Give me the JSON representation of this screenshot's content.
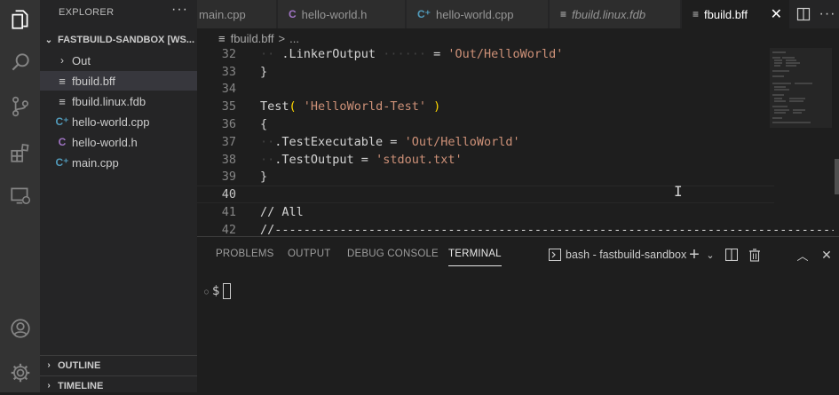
{
  "sidebar": {
    "title": "EXPLORER",
    "more_icon": "ellipsis-icon",
    "workspace": "FASTBUILD-SANDBOX [WS...",
    "files": [
      {
        "label": "Out",
        "kind": "folder"
      },
      {
        "label": "fbuild.bff",
        "kind": "bff",
        "selected": true
      },
      {
        "label": "fbuild.linux.fdb",
        "kind": "fdb"
      },
      {
        "label": "hello-world.cpp",
        "kind": "cpp"
      },
      {
        "label": "hello-world.h",
        "kind": "h"
      },
      {
        "label": "main.cpp",
        "kind": "cpp"
      }
    ],
    "outline": "OUTLINE",
    "timeline": "TIMELINE"
  },
  "tabs": [
    {
      "label": "main.cpp",
      "icon": "cpp-icon",
      "active": false
    },
    {
      "label": "hello-world.h",
      "icon": "c-icon",
      "active": false
    },
    {
      "label": "hello-world.cpp",
      "icon": "cpp-icon",
      "active": false
    },
    {
      "label": "fbuild.linux.fdb",
      "icon": "file-lines-icon",
      "active": false,
      "italic": true
    },
    {
      "label": "fbuild.bff",
      "icon": "file-lines-icon",
      "active": true
    }
  ],
  "breadcrumb": {
    "file": "fbuild.bff",
    "separator": ">",
    "rest": "..."
  },
  "editor": {
    "lines": [
      {
        "n": "32",
        "text": "    .LinkerOutput      = 'Out/HelloWorld'"
      },
      {
        "n": "33",
        "text": "}"
      },
      {
        "n": "34",
        "text": ""
      },
      {
        "n": "35",
        "text": "Test( 'HelloWorld-Test' )"
      },
      {
        "n": "36",
        "text": "{"
      },
      {
        "n": "37",
        "text": "  .TestExecutable = 'Out/HelloWorld'"
      },
      {
        "n": "38",
        "text": "  .TestOutput = 'stdout.txt'"
      },
      {
        "n": "39",
        "text": "}"
      },
      {
        "n": "40",
        "text": ""
      },
      {
        "n": "41",
        "text": "// All"
      },
      {
        "n": "42",
        "text": "//------------------------------------------------------------------------------"
      }
    ],
    "current_line": "40"
  },
  "panel": {
    "tabs": [
      "PROBLEMS",
      "OUTPUT",
      "DEBUG CONSOLE",
      "TERMINAL"
    ],
    "active_tab": "TERMINAL",
    "terminal_name": "bash - fastbuild-sandbox",
    "prompt": "$"
  },
  "colors": {
    "activity_bar": "#333333",
    "sidebar": "#252526",
    "editor": "#1e1e1e",
    "string": "#ce9178",
    "bracket": "#ffd700",
    "comment": "#6a9955"
  }
}
